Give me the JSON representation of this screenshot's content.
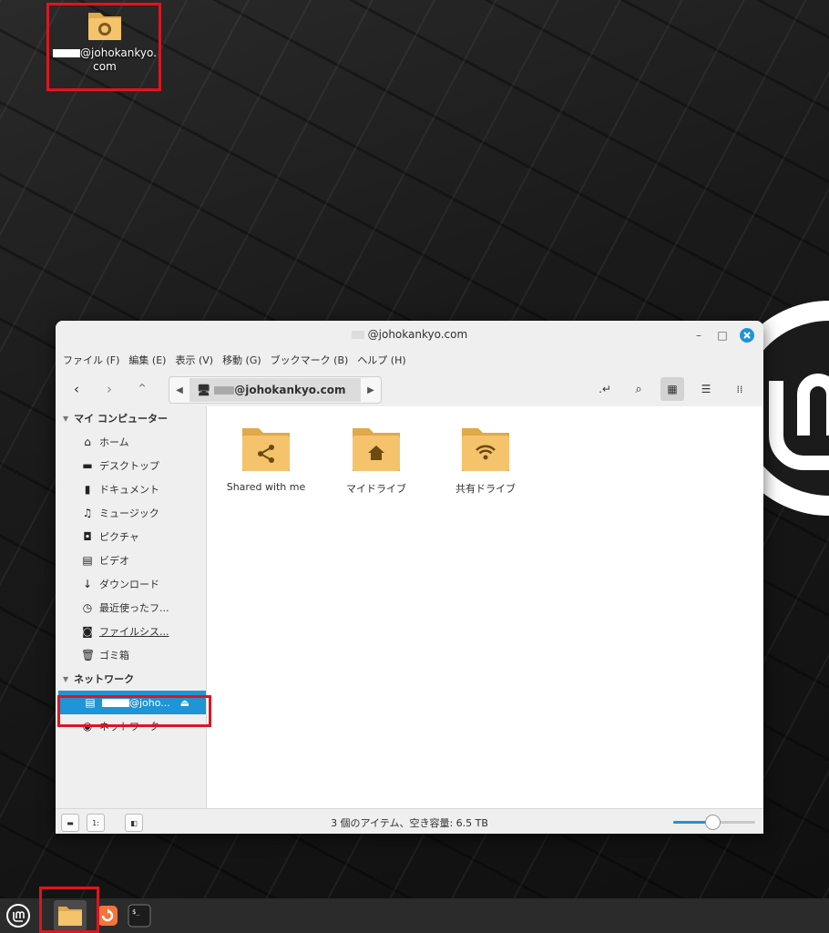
{
  "desktop": {
    "icon_label_line1": "@johokankyo.",
    "icon_label_line2": "com"
  },
  "window": {
    "title": "@johokankyo.com",
    "menu": [
      "ファイル (F)",
      "編集 (E)",
      "表示 (V)",
      "移動 (G)",
      "ブックマーク (B)",
      "ヘルプ (H)"
    ],
    "path_crumb": "@johokankyo.com",
    "sidebar": {
      "my_computer_header": "マイ コンピューター",
      "places": [
        {
          "label": "ホーム",
          "icon": "home-icon"
        },
        {
          "label": "デスクトップ",
          "icon": "desktop-icon"
        },
        {
          "label": "ドキュメント",
          "icon": "document-icon"
        },
        {
          "label": "ミュージック",
          "icon": "music-icon"
        },
        {
          "label": "ピクチャ",
          "icon": "camera-icon"
        },
        {
          "label": "ビデオ",
          "icon": "video-icon"
        },
        {
          "label": "ダウンロード",
          "icon": "download-icon"
        },
        {
          "label": "最近使ったフ...",
          "icon": "recent-icon"
        },
        {
          "label": "ファイルシス...",
          "icon": "drive-icon"
        },
        {
          "label": "ゴミ箱",
          "icon": "trash-icon"
        }
      ],
      "network_header": "ネットワーク",
      "network_items": [
        {
          "label": "@joho...",
          "icon": "server-icon",
          "selected": true
        },
        {
          "label": "ネットワーク",
          "icon": "network-globe-icon",
          "selected": false
        }
      ]
    },
    "files": [
      {
        "label": "Shared with me",
        "icon": "share-folder-icon"
      },
      {
        "label": "マイドライブ",
        "icon": "home-folder-icon"
      },
      {
        "label": "共有ドライブ",
        "icon": "wifi-folder-icon"
      }
    ],
    "status_text": "3 個のアイテム、空き容量: 6.5 TB",
    "zoom_level": 0.48
  },
  "colors": {
    "accent": "#1f94d6",
    "folder": "#f5c36b",
    "folder_dark": "#e0a94a",
    "highlight": "#e0141e"
  }
}
